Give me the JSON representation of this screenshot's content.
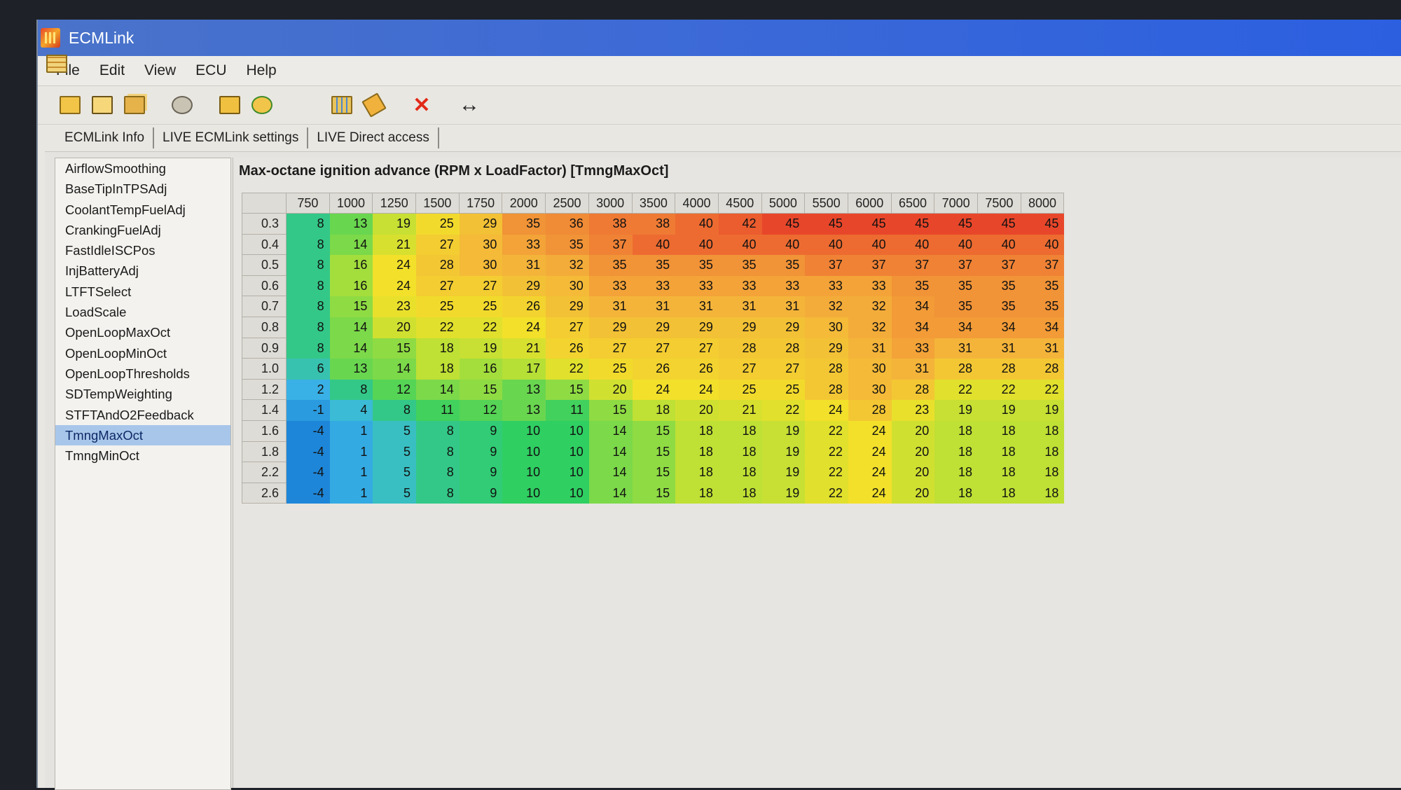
{
  "window": {
    "title": "ECMLink"
  },
  "menu": [
    "File",
    "Edit",
    "View",
    "ECU",
    "Help"
  ],
  "toolbar": {
    "icons": [
      "open-folder-icon",
      "save-icon",
      "save-all-icon",
      "settings-icon",
      "load-map-icon",
      "refresh-icon",
      "map-table-icon",
      "map-grid-icon",
      "wand-icon",
      "delete-icon",
      "swap-arrows-icon"
    ]
  },
  "tabs": [
    "ECMLink Info",
    "LIVE ECMLink settings",
    "LIVE Direct access"
  ],
  "active_tab": 2,
  "sidebar": {
    "items": [
      "AirflowSmoothing",
      "BaseTipInTPSAdj",
      "CoolantTempFuelAdj",
      "CrankingFuelAdj",
      "FastIdleISCPos",
      "InjBatteryAdj",
      "LTFTSelect",
      "LoadScale",
      "OpenLoopMaxOct",
      "OpenLoopMinOct",
      "OpenLoopThresholds",
      "SDTempWeighting",
      "STFTAndO2Feedback",
      "TmngMaxOct",
      "TmngMinOct"
    ],
    "selected": 13
  },
  "map": {
    "title": "Max-octane ignition advance (RPM x LoadFactor) [TmngMaxOct]",
    "rpm": [
      "750",
      "1000",
      "1250",
      "1500",
      "1750",
      "2000",
      "2500",
      "3000",
      "3500",
      "4000",
      "4500",
      "5000",
      "5500",
      "6000",
      "6500",
      "7000",
      "7500",
      "8000"
    ],
    "load": [
      "0.3",
      "0.4",
      "0.5",
      "0.6",
      "0.7",
      "0.8",
      "0.9",
      "1.0",
      "1.2",
      "1.4",
      "1.6",
      "1.8",
      "2.2",
      "2.6"
    ],
    "values": [
      [
        8,
        13,
        19,
        25,
        29,
        35,
        36,
        38,
        38,
        40,
        42,
        45,
        45,
        45,
        45,
        45,
        45,
        45
      ],
      [
        8,
        14,
        21,
        27,
        30,
        33,
        35,
        37,
        40,
        40,
        40,
        40,
        40,
        40,
        40,
        40,
        40,
        40
      ],
      [
        8,
        16,
        24,
        28,
        30,
        31,
        32,
        35,
        35,
        35,
        35,
        35,
        37,
        37,
        37,
        37,
        37,
        37
      ],
      [
        8,
        16,
        24,
        27,
        27,
        29,
        30,
        33,
        33,
        33,
        33,
        33,
        33,
        33,
        35,
        35,
        35,
        35
      ],
      [
        8,
        15,
        23,
        25,
        25,
        26,
        29,
        31,
        31,
        31,
        31,
        31,
        32,
        32,
        34,
        35,
        35,
        35
      ],
      [
        8,
        14,
        20,
        22,
        22,
        24,
        27,
        29,
        29,
        29,
        29,
        29,
        30,
        32,
        34,
        34,
        34,
        34
      ],
      [
        8,
        14,
        15,
        18,
        19,
        21,
        26,
        27,
        27,
        27,
        28,
        28,
        29,
        31,
        33,
        31,
        31,
        31
      ],
      [
        6,
        13,
        14,
        18,
        16,
        17,
        22,
        25,
        26,
        26,
        27,
        27,
        28,
        30,
        31,
        28,
        28,
        28
      ],
      [
        2,
        8,
        12,
        14,
        15,
        13,
        15,
        20,
        24,
        24,
        25,
        25,
        28,
        30,
        28,
        22,
        22,
        22
      ],
      [
        -1,
        4,
        8,
        11,
        12,
        13,
        11,
        15,
        18,
        20,
        21,
        22,
        24,
        28,
        23,
        19,
        19,
        19
      ],
      [
        -4,
        1,
        5,
        8,
        9,
        10,
        10,
        14,
        15,
        18,
        18,
        19,
        22,
        24,
        20,
        18,
        18,
        18
      ],
      [
        -4,
        1,
        5,
        8,
        9,
        10,
        10,
        14,
        15,
        18,
        18,
        19,
        22,
        24,
        20,
        18,
        18,
        18
      ],
      [
        -4,
        1,
        5,
        8,
        9,
        10,
        10,
        14,
        15,
        18,
        18,
        19,
        22,
        24,
        20,
        18,
        18,
        18
      ],
      [
        -4,
        1,
        5,
        8,
        9,
        10,
        10,
        14,
        15,
        18,
        18,
        19,
        22,
        24,
        20,
        18,
        18,
        18
      ]
    ],
    "color_scale": [
      "#1e86d8",
      "#3db8e8",
      "#2fcf62",
      "#b6e036",
      "#f2e02a",
      "#f4b43a",
      "#ef7a34",
      "#e8462a"
    ]
  }
}
